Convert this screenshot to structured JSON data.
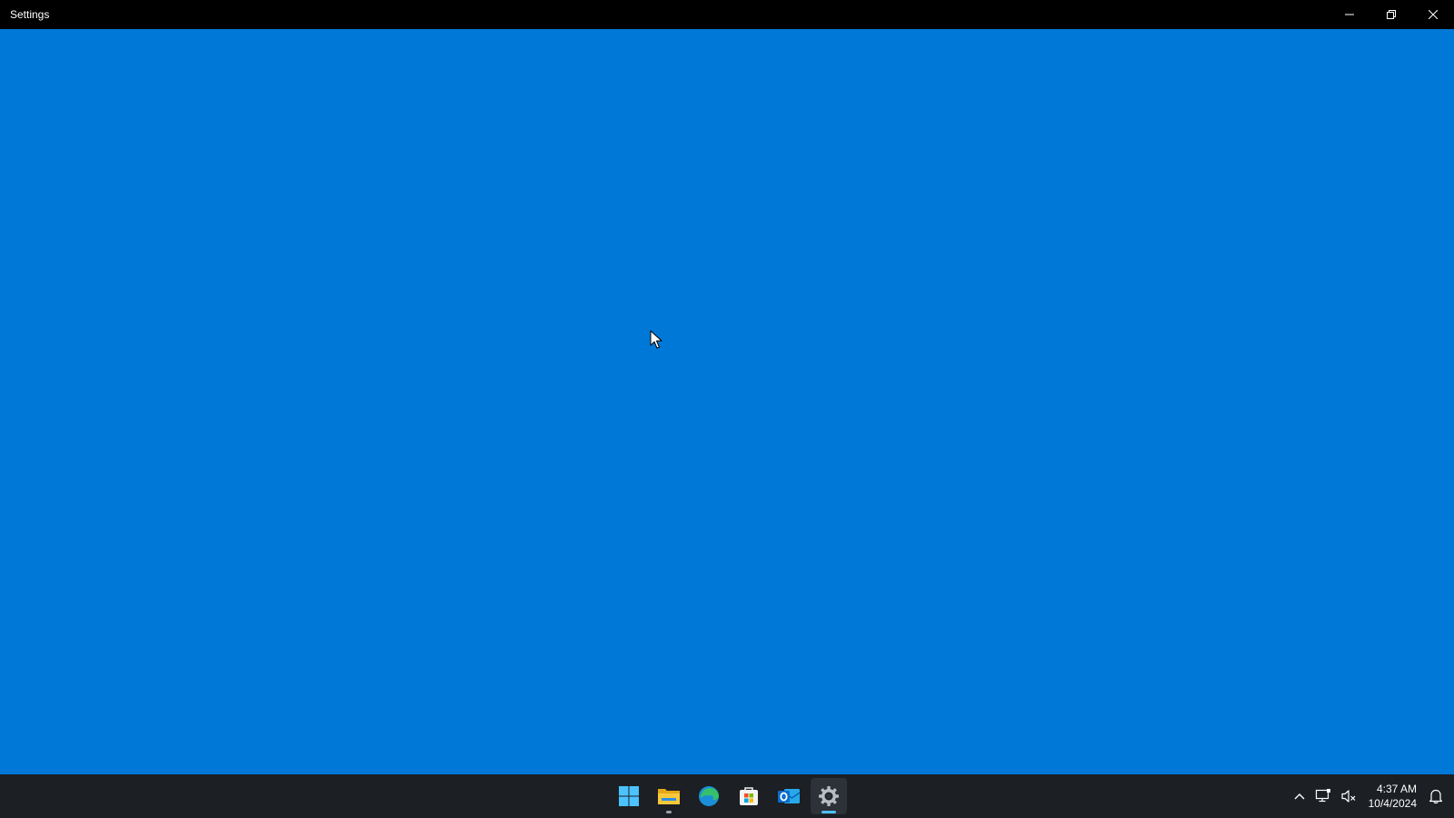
{
  "window": {
    "title": "Settings",
    "background": "#0078d7"
  },
  "titlebar_controls": {
    "minimize": "minimize-icon",
    "restore": "restore-icon",
    "close": "close-icon"
  },
  "taskbar": {
    "pinned": [
      {
        "name": "start",
        "icon": "windows-logo-icon",
        "state": "none"
      },
      {
        "name": "file-explorer",
        "icon": "folder-icon",
        "state": "open"
      },
      {
        "name": "edge",
        "icon": "edge-icon",
        "state": "none"
      },
      {
        "name": "store",
        "icon": "store-icon",
        "state": "none"
      },
      {
        "name": "outlook",
        "icon": "outlook-icon",
        "state": "none"
      },
      {
        "name": "settings",
        "icon": "gear-icon",
        "state": "focus"
      }
    ],
    "accent": "#4cc2ff"
  },
  "tray": {
    "clock": {
      "time": "4:37 AM",
      "date": "10/4/2024"
    }
  }
}
